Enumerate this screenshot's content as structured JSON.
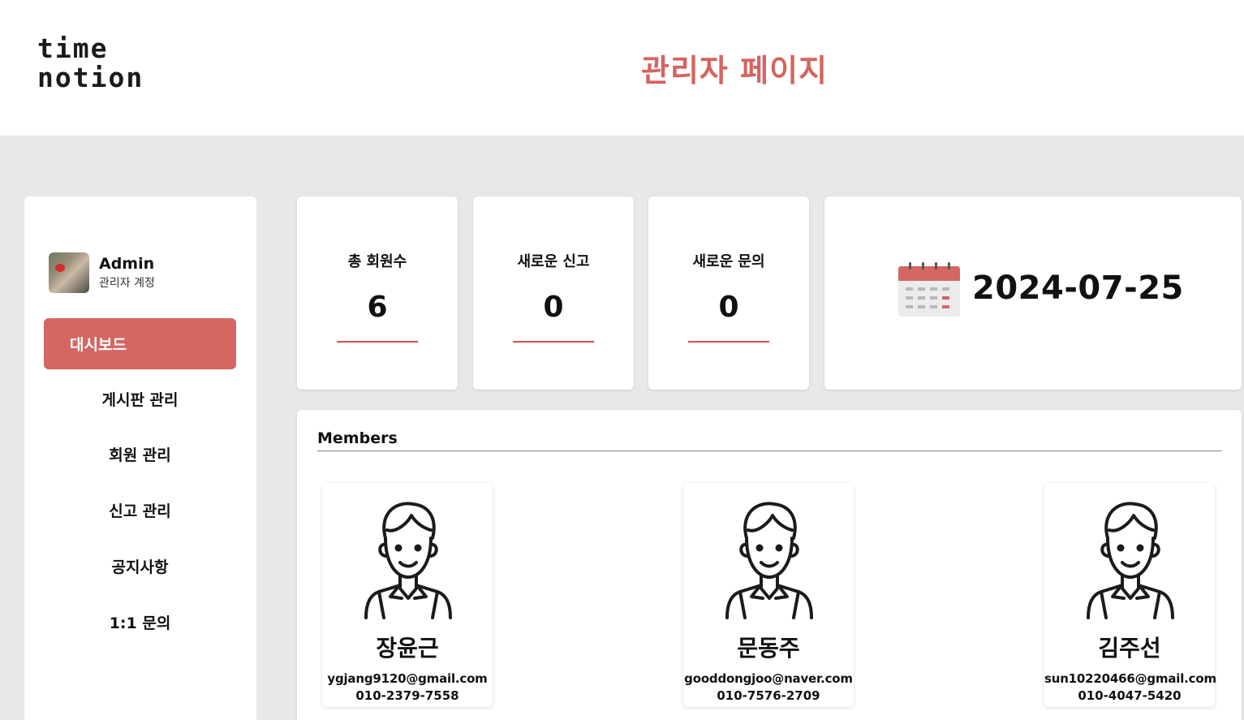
{
  "header": {
    "logo_line1": "time",
    "logo_line2": "notion",
    "title": "관리자 페이지"
  },
  "profile": {
    "name": "Admin",
    "role": "관리자 계정"
  },
  "nav": [
    {
      "label": "대시보드",
      "active": true
    },
    {
      "label": "게시판 관리"
    },
    {
      "label": "회원 관리"
    },
    {
      "label": "신고 관리"
    },
    {
      "label": "공지사항"
    },
    {
      "label": "1:1 문의"
    }
  ],
  "stats": [
    {
      "label": "총 회원수",
      "value": "6"
    },
    {
      "label": "새로운 신고",
      "value": "0"
    },
    {
      "label": "새로운 문의",
      "value": "0"
    }
  ],
  "date": "2024-07-25",
  "members": {
    "title": "Members",
    "list": [
      {
        "name": "장윤근",
        "email": "ygjang9120@gmail.com",
        "phone": "010-2379-7558"
      },
      {
        "name": "문동주",
        "email": "gooddongjoo@naver.com",
        "phone": "010-7576-2709"
      },
      {
        "name": "김주선",
        "email": "sun10220466@gmail.com",
        "phone": "010-4047-5420"
      }
    ]
  },
  "colors": {
    "accent": "#d46762",
    "title": "#d4645f",
    "background": "#e8e8e8"
  }
}
